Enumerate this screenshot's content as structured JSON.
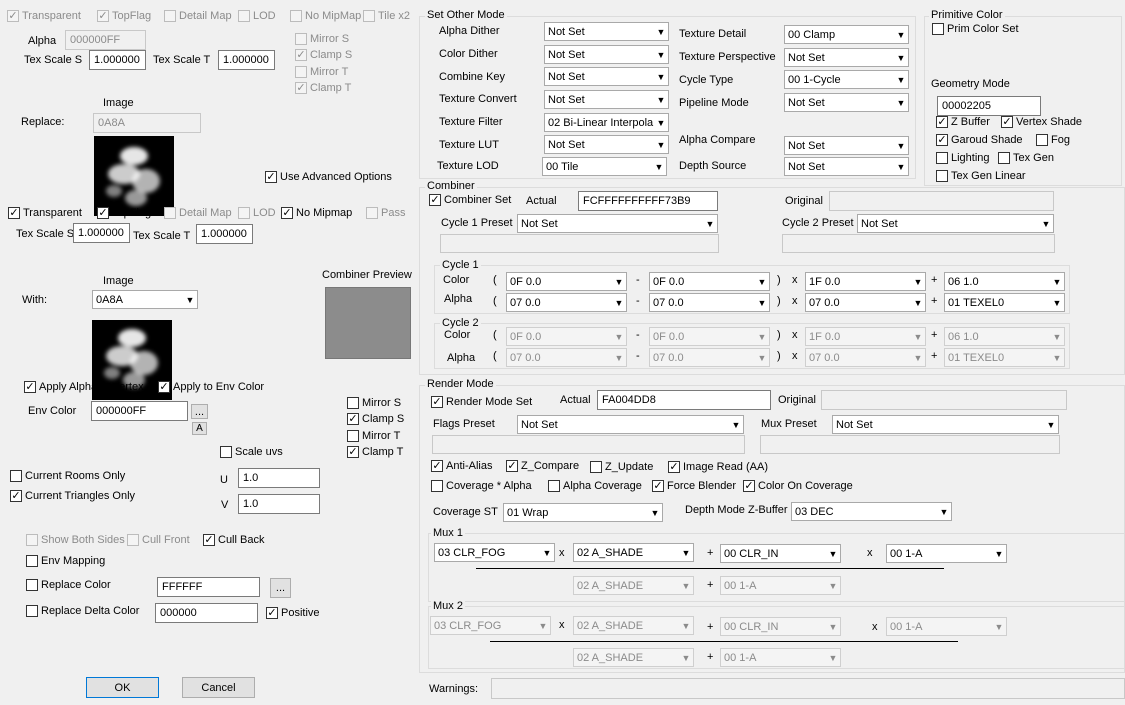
{
  "top_flags": {
    "transparent": "Transparent",
    "topflag": "TopFlag",
    "detail_map": "Detail Map",
    "lod": "LOD",
    "no_mipmap": "No MipMap",
    "tile_x2": "Tile x2"
  },
  "alpha": {
    "label": "Alpha",
    "value": "000000FF"
  },
  "tex_scale_top": {
    "s_label": "Tex Scale S",
    "s_value": "1.000000",
    "t_label": "Tex Scale T",
    "t_value": "1.000000"
  },
  "mirror_top": {
    "mirror_s": "Mirror S",
    "clamp_s": "Clamp S",
    "mirror_t": "Mirror T",
    "clamp_t": "Clamp T"
  },
  "image1": {
    "label": "Image",
    "replace_label": "Replace:",
    "replace_value": "0A8A"
  },
  "use_advanced": "Use Advanced Options",
  "flags2": {
    "transparent": "Transparent",
    "topflag": "TopFlag",
    "detail_map": "Detail Map",
    "lod": "LOD",
    "no_mipmap": "No Mipmap",
    "pass": "Pass"
  },
  "tex_scale2": {
    "s_label": "Tex Scale S",
    "s_value": "1.000000",
    "t_label": "Tex Scale T",
    "t_value": "1.000000"
  },
  "image2": {
    "label": "Image",
    "with_label": "With:",
    "with_value": "0A8A"
  },
  "combiner_preview": {
    "label": "Combiner Preview",
    "color": "#8c8c8c"
  },
  "apply": {
    "alpha_to_vertex": "Apply Alpha to Vertex",
    "to_env": "Apply to Env Color"
  },
  "env": {
    "label": "Env Color",
    "value": "000000FF",
    "dots": "...",
    "a_btn": "A"
  },
  "mirror2": {
    "mirror_s": "Mirror S",
    "clamp_s": "Clamp S",
    "mirror_t": "Mirror T",
    "clamp_t": "Clamp T"
  },
  "scale_uvs": {
    "label": "Scale uvs",
    "u_label": "U",
    "u_value": "1.0",
    "v_label": "V",
    "v_value": "1.0"
  },
  "rooms": {
    "current_rooms": "Current Rooms Only",
    "current_triangles": "Current Triangles Only"
  },
  "cull": {
    "show_both": "Show Both Sides",
    "cull_front": "Cull Front",
    "cull_back": "Cull Back"
  },
  "env_mapping": "Env Mapping",
  "replace_color": {
    "label": "Replace Color",
    "value": "FFFFFF",
    "dots": "..."
  },
  "replace_delta": {
    "label": "Replace Delta Color",
    "value": "000000",
    "positive": "Positive"
  },
  "buttons": {
    "ok": "OK",
    "cancel": "Cancel"
  },
  "other_mode": {
    "title": "Set Other Mode",
    "left": [
      {
        "label": "Alpha Dither",
        "value": "Not Set"
      },
      {
        "label": "Color Dither",
        "value": "Not Set"
      },
      {
        "label": "Combine Key",
        "value": "Not Set"
      },
      {
        "label": "Texture Convert",
        "value": "Not Set"
      },
      {
        "label": "Texture Filter",
        "value": "02 Bi-Linear Interpola"
      },
      {
        "label": "Texture LUT",
        "value": "Not Set"
      },
      {
        "label": "Texture LOD",
        "value": "00 Tile"
      }
    ],
    "right": [
      {
        "label": "Texture Detail",
        "value": "00 Clamp"
      },
      {
        "label": "Texture Perspective",
        "value": "Not Set"
      },
      {
        "label": "Cycle Type",
        "value": "00 1-Cycle"
      },
      {
        "label": "Pipeline Mode",
        "value": "Not Set"
      },
      {
        "label": "Alpha Compare",
        "value": "Not Set"
      },
      {
        "label": "Depth Source",
        "value": "Not Set"
      }
    ]
  },
  "primitive": {
    "title": "Primitive Color",
    "set": "Prim Color Set"
  },
  "geometry": {
    "title": "Geometry Mode",
    "value": "00002205",
    "z_buffer": "Z Buffer",
    "vertex_shade": "Vertex Shade",
    "garoud": "Garoud Shade",
    "fog": "Fog",
    "lighting": "Lighting",
    "tex_gen": "Tex Gen",
    "tex_gen_linear": "Tex Gen Linear"
  },
  "combiner": {
    "title": "Combiner",
    "set": "Combiner Set",
    "actual_label": "Actual",
    "actual_value": "FCFFFFFFFFFF73B9",
    "original_label": "Original",
    "c1_label": "Cycle 1 Preset",
    "c1_value": "Not Set",
    "c2_label": "Cycle 2 Preset",
    "c2_value": "Not Set",
    "cycle1": {
      "title": "Cycle 1",
      "color_label": "Color",
      "alpha_label": "Alpha",
      "color": [
        "0F 0.0",
        "0F 0.0",
        "1F 0.0",
        "06 1.0"
      ],
      "alpha": [
        "07 0.0",
        "07 0.0",
        "07 0.0",
        "01 TEXEL0"
      ]
    },
    "cycle2": {
      "title": "Cycle 2",
      "color_label": "Color",
      "alpha_label": "Alpha",
      "color": [
        "0F 0.0",
        "0F 0.0",
        "1F 0.0",
        "06 1.0"
      ],
      "alpha": [
        "07 0.0",
        "07 0.0",
        "07 0.0",
        "01 TEXEL0"
      ]
    },
    "ops": {
      "open": "(",
      "minus": "-",
      "close": ")",
      "times": "x",
      "plus": "+"
    }
  },
  "render_mode": {
    "title": "Render Mode",
    "set": "Render Mode Set",
    "actual_label": "Actual",
    "actual_value": "FA004DD8",
    "original_label": "Original",
    "flags_label": "Flags Preset",
    "flags_value": "Not Set",
    "mux_label": "Mux Preset",
    "mux_value": "Not Set",
    "anti_alias": "Anti-Alias",
    "z_compare": "Z_Compare",
    "z_update": "Z_Update",
    "image_read": "Image Read (AA)",
    "coverage_alpha": "Coverage * Alpha",
    "alpha_coverage": "Alpha Coverage",
    "force_blender": "Force Blender",
    "color_on_cov": "Color On Coverage",
    "coverage_st_label": "Coverage ST",
    "coverage_st_value": "01 Wrap",
    "depth_mode_label": "Depth Mode Z-Buffer",
    "depth_mode_value": "03 DEC",
    "mux1": {
      "title": "Mux 1",
      "a": "03 CLR_FOG",
      "b": "02 A_SHADE",
      "c": "00 CLR_IN",
      "d": "00 1-A",
      "e": "02 A_SHADE",
      "f": "00 1-A"
    },
    "mux2": {
      "title": "Mux 2",
      "a": "03 CLR_FOG",
      "b": "02 A_SHADE",
      "c": "00 CLR_IN",
      "d": "00 1-A",
      "e": "02 A_SHADE",
      "f": "00 1-A"
    }
  },
  "warnings": {
    "label": "Warnings:",
    "value": ""
  }
}
